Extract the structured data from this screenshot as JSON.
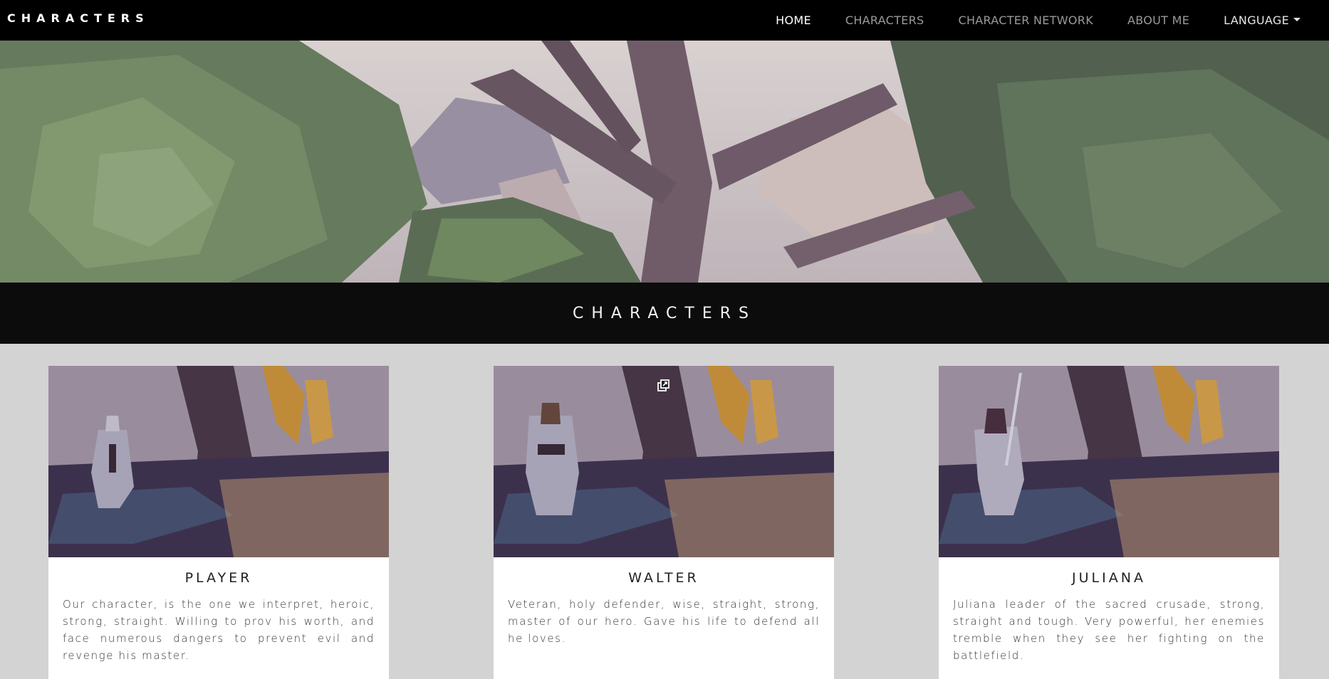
{
  "navbar": {
    "brand": "CHARACTERS",
    "links": {
      "home": "HOME",
      "characters": "CHARACTERS",
      "network": "CHARACTER NETWORK",
      "about": "ABOUT ME",
      "language": "LANGUAGE"
    }
  },
  "hero": {
    "image": "low-poly-forest-scene"
  },
  "section": {
    "title": "CHARACTERS"
  },
  "cards": [
    {
      "name": "PLAYER",
      "description": "Our character, is the one we interpret, heroic, strong, straight. Willing to prov his worth, and face numerous dangers to prevent evil and revenge his master.",
      "image": "player-knight-in-forest"
    },
    {
      "name": "WALTER",
      "description": "Veteran, holy defender, wise, straight, strong, master of our hero. Gave his life to defend all he loves.",
      "image": "walter-armored-knight-in-forest"
    },
    {
      "name": "JULIANA",
      "description": "Juliana leader of the sacred crusade, strong, straight and tough. Very powerful, her enemies tremble when they see her fighting on the battlefield.",
      "image": "juliana-warrior-with-sword-in-forest"
    }
  ],
  "icons": {
    "popout": "open-in-new-window-icon",
    "caret": "caret-down-icon"
  },
  "colors": {
    "navbar_bg": "#000000",
    "banner_bg": "#0c0c0c",
    "page_bg": "#d3d3d3",
    "card_bg": "#ffffff",
    "nav_active": "#ffffff",
    "nav_inactive": "#9a9a9a"
  }
}
